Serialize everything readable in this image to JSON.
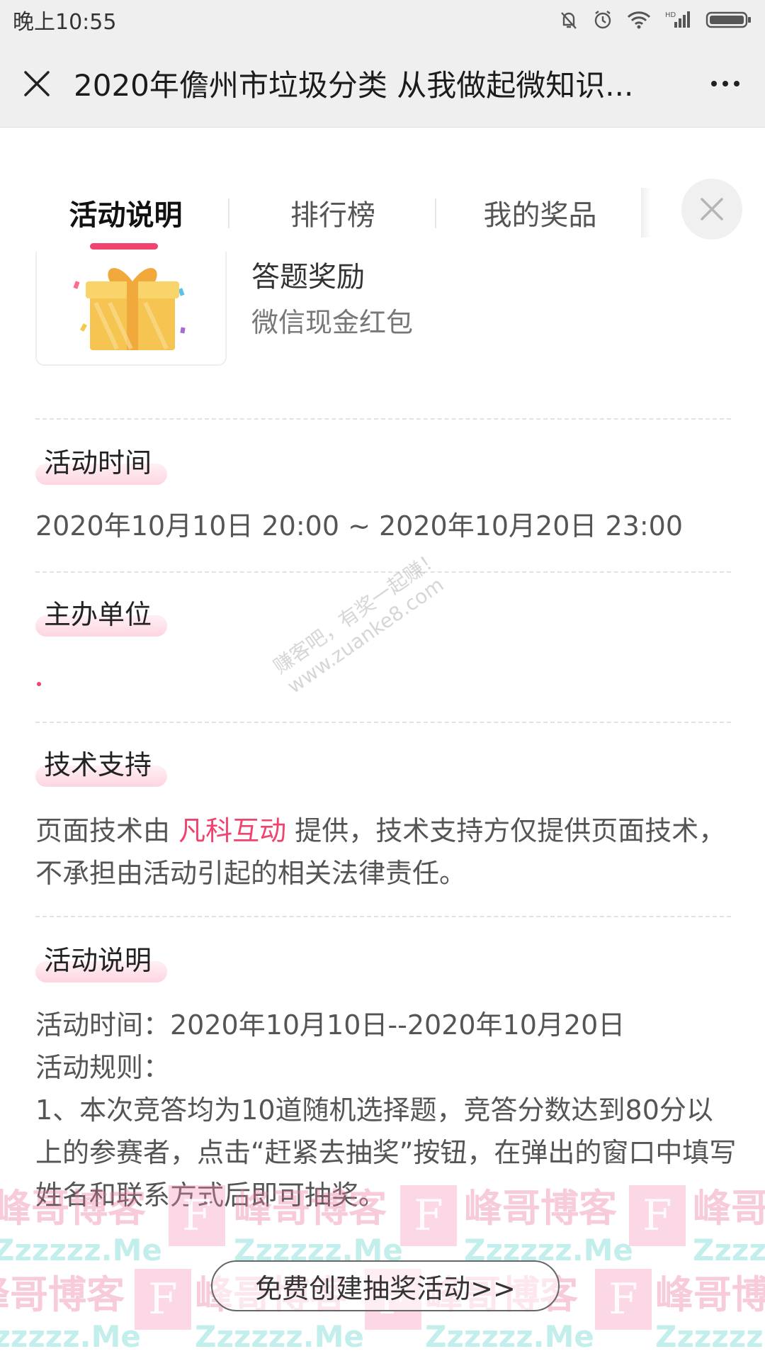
{
  "status_bar": {
    "time": "晚上10:55"
  },
  "title_bar": {
    "title": "2020年儋州市垃圾分类 从我做起微知识..."
  },
  "tabs": [
    "活动说明",
    "排行榜",
    "我的奖品"
  ],
  "prize": {
    "title": "答题奖励",
    "subtitle": "微信现金红包"
  },
  "sections": {
    "time_label": "活动时间",
    "time_value": "2020年10月10日 20:00 ~ 2020年10月20日 23:00",
    "organizer_label": "主办单位",
    "support_label": "技术支持",
    "support_text_before": "页面技术由 ",
    "support_link": "凡科互动",
    "support_text_after": " 提供，技术支持方仅提供页面技术，不承担由活动引起的相关法律责任。",
    "desc_label": "活动说明",
    "desc_line1": "活动时间：2020年10月10日--2020年10月20日",
    "desc_line2": "活动规则：",
    "desc_line3": "1、本次竞答均为10道随机选择题，竞答分数达到80分以上的参赛者，点击“赶紧去抽奖”按钮，在弹出的窗口中填写姓名和联系方式后即可抽奖。"
  },
  "cta": {
    "label": "免费创建抽奖活动>>"
  },
  "watermarks": {
    "diag_line1": "赚客吧，有奖一起赚！",
    "diag_line2": "www.zuanke8.com",
    "brand_cn": "峰哥博客",
    "brand_en": "Zzzzzz.Me",
    "brand_letter": "F"
  }
}
